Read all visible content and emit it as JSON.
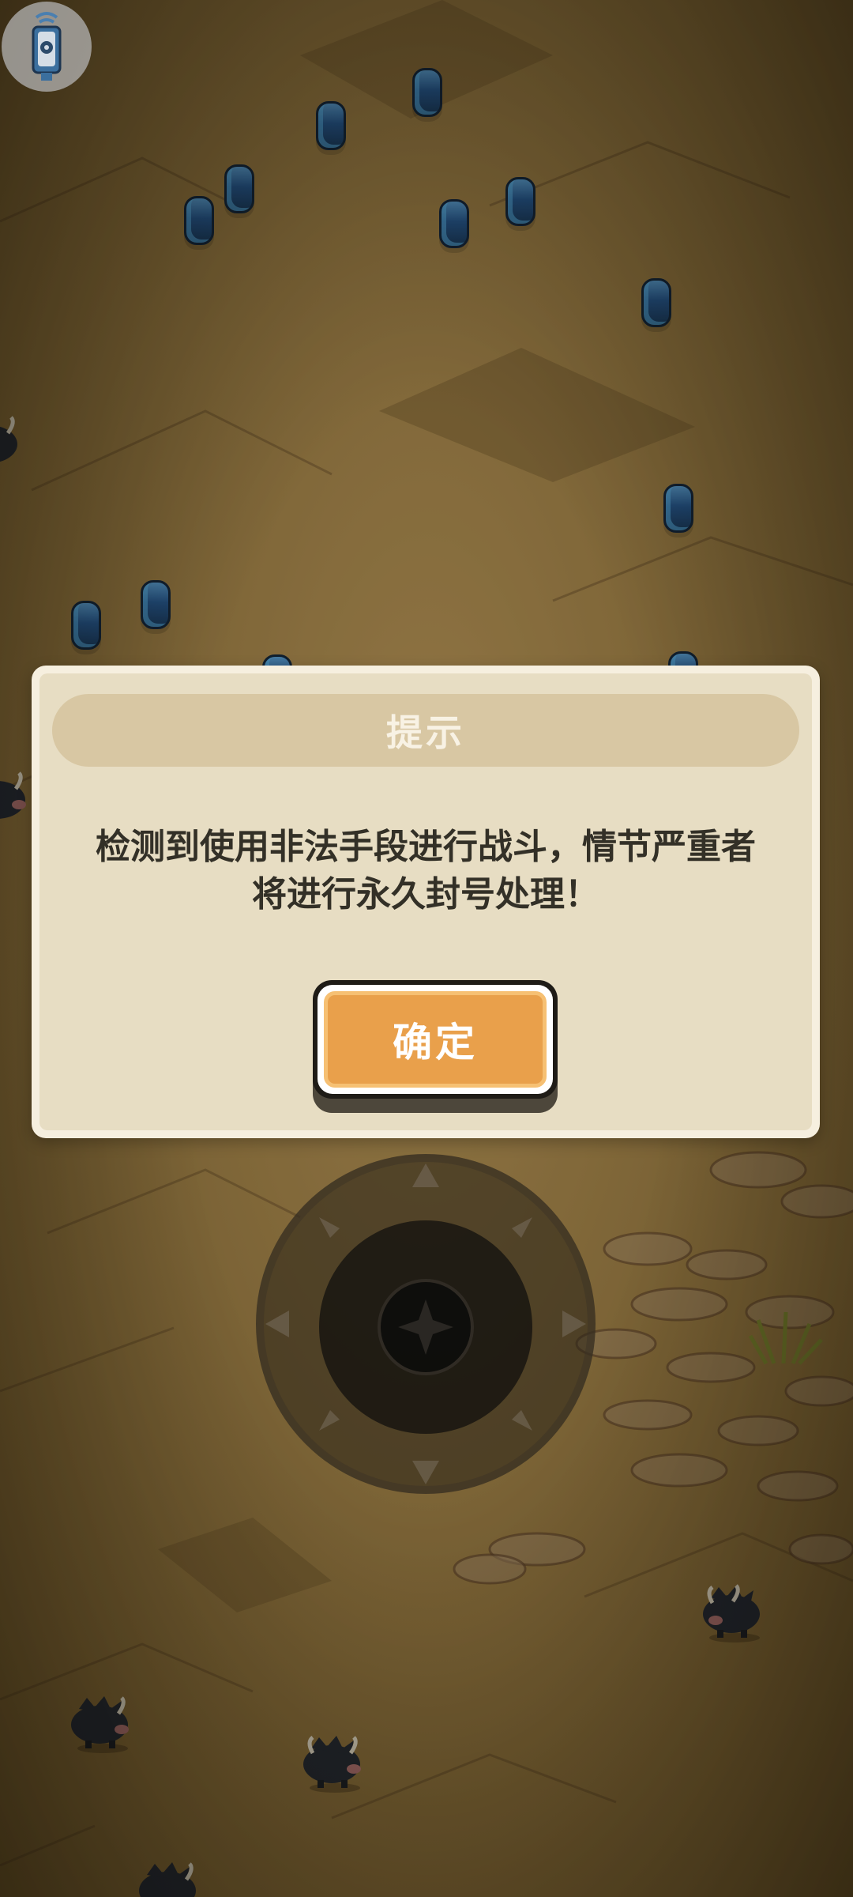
{
  "dialog": {
    "title": "提示",
    "message": "检测到使用非法手段进行战斗，情节严重者将进行永久封号处理！",
    "confirm_label": "确定"
  },
  "hud": {
    "device_icon": "speaker-device-icon",
    "joystick_icon": "virtual-joystick-icon"
  },
  "scene": {
    "terrain": "desert-ground",
    "crystal_icon": "blue-crystal-icon",
    "enemy_icon": "black-yak-icon"
  },
  "colors": {
    "dialog_background": "#e7ddc3",
    "title_bar": "#d8c7a3",
    "button_orange": "#e9a04b",
    "message_text": "#333027"
  }
}
